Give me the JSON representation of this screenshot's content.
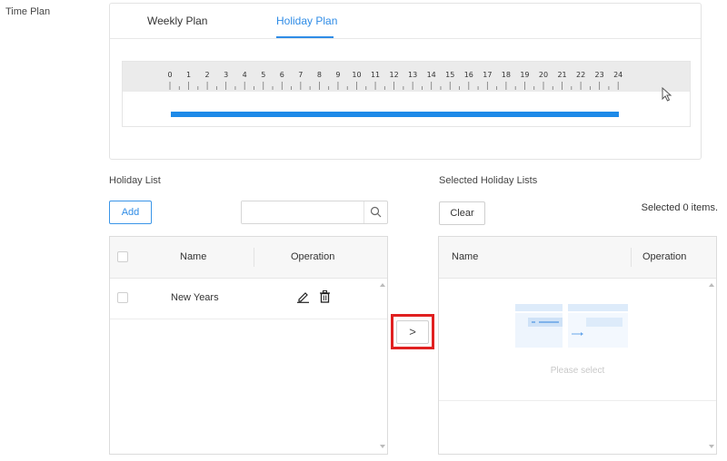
{
  "form": {
    "time_plan_label": "Time Plan"
  },
  "tabs": [
    {
      "label": "Weekly Plan",
      "active": false
    },
    {
      "label": "Holiday Plan",
      "active": true
    }
  ],
  "timeline": {
    "hours": [
      "0",
      "1",
      "2",
      "3",
      "4",
      "5",
      "6",
      "7",
      "8",
      "9",
      "10",
      "11",
      "12",
      "13",
      "14",
      "15",
      "16",
      "17",
      "18",
      "19",
      "20",
      "21",
      "22",
      "23",
      "24"
    ],
    "selected_start_hour": 0,
    "selected_end_hour": 24,
    "bar_color": "#1e8ae8"
  },
  "holiday_list": {
    "title": "Holiday List",
    "add_label": "Add",
    "search_value": "",
    "search_icon": "search-icon",
    "columns": [
      "Name",
      "Operation"
    ],
    "rows": [
      {
        "name": "New Years",
        "actions": [
          "edit-icon",
          "delete-icon"
        ]
      }
    ]
  },
  "transfer": {
    "label": ">"
  },
  "selected_lists": {
    "title": "Selected Holiday Lists",
    "clear_label": "Clear",
    "count_text": "Selected 0 items.",
    "columns": [
      "Name",
      "Operation"
    ],
    "empty_text": "Please select"
  },
  "colors": {
    "accent": "#2f8ce6",
    "highlight_border": "#e02020"
  }
}
